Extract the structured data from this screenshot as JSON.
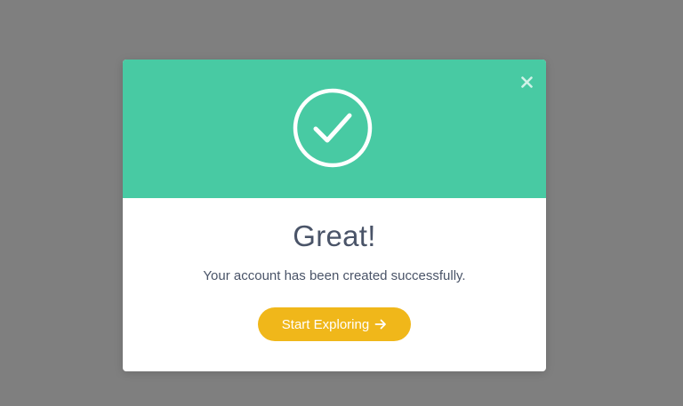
{
  "modal": {
    "title": "Great!",
    "message": "Your account has been created successfully.",
    "cta_label": "Start Exploring",
    "close_icon": "close-icon",
    "status_icon": "check-circle-icon",
    "cta_icon": "arrow-right-icon"
  },
  "colors": {
    "backdrop": "#7f7f7f",
    "header": "#48caa3",
    "cta": "#f0b71a",
    "text": "#4a5468",
    "white": "#ffffff"
  }
}
